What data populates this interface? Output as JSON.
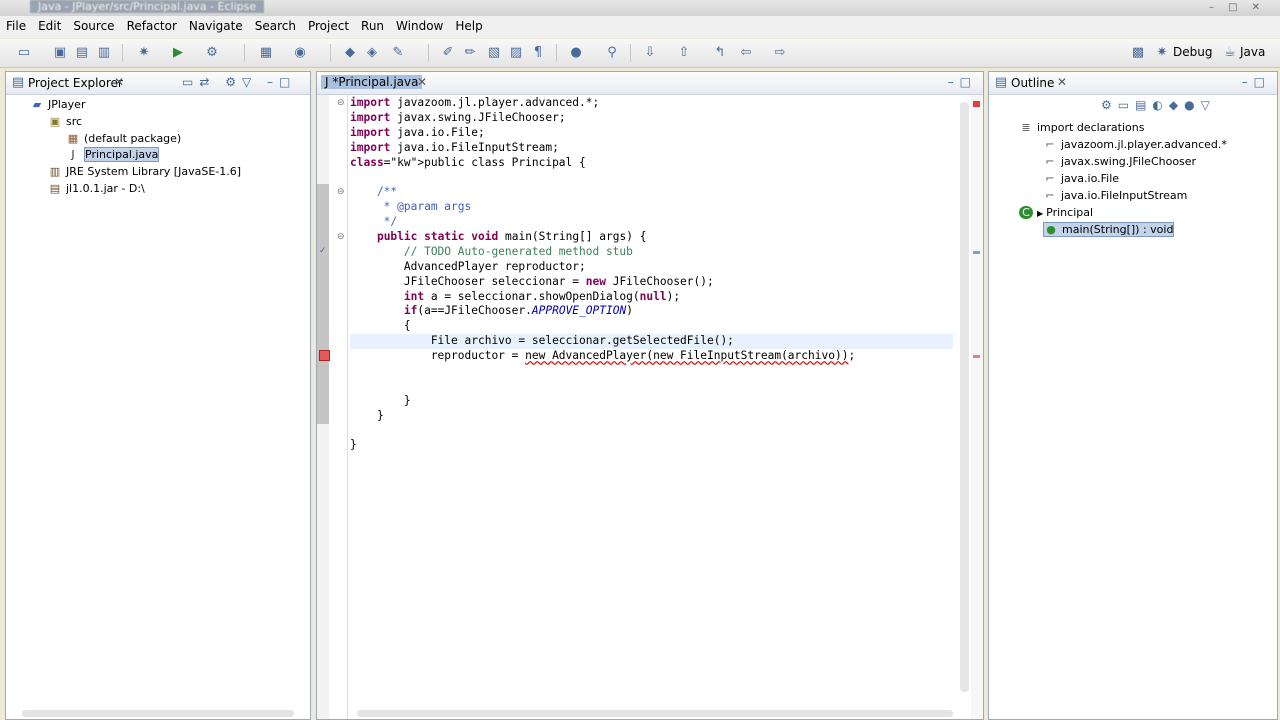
{
  "window": {
    "title": "Java - JPlayer/src/Principal.java - Eclipse"
  },
  "menu": [
    "File",
    "Edit",
    "Source",
    "Refactor",
    "Navigate",
    "Search",
    "Project",
    "Run",
    "Window",
    "Help"
  ],
  "perspectives": {
    "debug": "Debug",
    "java": "Java"
  },
  "project_explorer": {
    "title": "Project Explorer",
    "items": [
      {
        "label": "JPlayer",
        "icon": "project-icon"
      },
      {
        "label": "src",
        "icon": "source-folder-icon"
      },
      {
        "label": "(default package)",
        "icon": "package-icon"
      },
      {
        "label": "Principal.java",
        "icon": "java-file-icon"
      },
      {
        "label": "JRE System Library [JavaSE-1.6]",
        "icon": "library-icon"
      },
      {
        "label": "jl1.0.1.jar - D:\\",
        "icon": "jar-icon"
      }
    ]
  },
  "editor": {
    "tab": "*Principal.java",
    "lines": [
      "import javazoom.jl.player.advanced.*;",
      "import javax.swing.JFileChooser;",
      "import java.io.File;",
      "import java.io.FileInputStream;",
      "public class Principal {",
      "",
      "    /**",
      "     * @param args",
      "     */",
      "    public static void main(String[] args) {",
      "        // TODO Auto-generated method stub",
      "        AdvancedPlayer reproductor;",
      "        JFileChooser seleccionar = new JFileChooser();",
      "        int a = seleccionar.showOpenDialog(null);",
      "        if(a==JFileChooser.APPROVE_OPTION)",
      "        {",
      "            File archivo = seleccionar.getSelectedFile();",
      "            reproductor = new AdvancedPlayer(new FileInputStream(archivo));",
      "",
      "",
      "        }",
      "    }",
      "",
      "}"
    ]
  },
  "outline": {
    "title": "Outline",
    "items": [
      {
        "label": "import declarations",
        "icon": "imports-icon"
      },
      {
        "label": "javazoom.jl.player.advanced.*",
        "icon": "import-icon"
      },
      {
        "label": "javax.swing.JFileChooser",
        "icon": "import-icon"
      },
      {
        "label": "java.io.File",
        "icon": "import-icon"
      },
      {
        "label": "java.io.FileInputStream",
        "icon": "import-icon"
      },
      {
        "label": "Principal",
        "icon": "class-icon"
      },
      {
        "label": "main(String[]) : void",
        "icon": "method-icon"
      }
    ]
  },
  "colors": {
    "keyword": "#7f0055",
    "comment": "#3f7f5f",
    "javadoc": "#3f5fbf",
    "static_field": "#0000c0",
    "error": "#e00000"
  }
}
